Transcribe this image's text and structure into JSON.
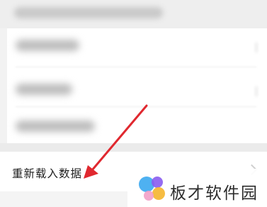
{
  "reload_item": {
    "label": "重新载入数据"
  },
  "watermark": {
    "text": "板才软件园"
  },
  "colors": {
    "arrow": "#e0282f",
    "logo": [
      "#3ba9f0",
      "#f5b52d",
      "#8a5cf0",
      "#f2a0c8"
    ]
  },
  "icons": {
    "reload_chevron": "chevron-right-icon",
    "logo": "watermark-logo-icon"
  }
}
